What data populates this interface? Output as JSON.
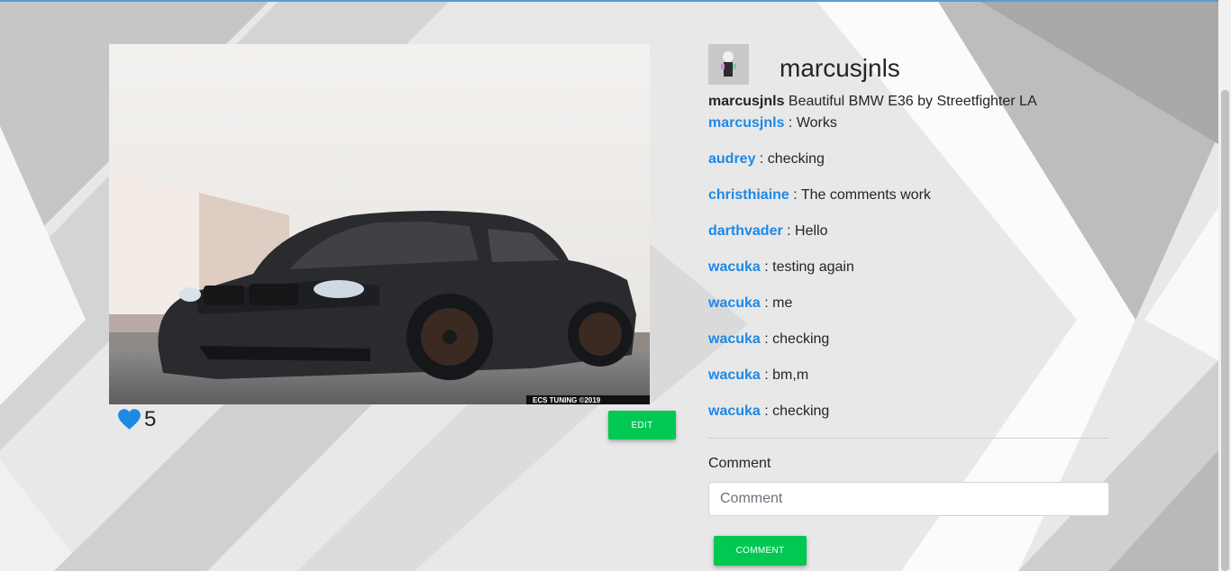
{
  "post": {
    "likes": "5",
    "edit_label": "EDIT",
    "image_watermark": "ECS TUNING ©2019"
  },
  "profile": {
    "username": "marcusjnls",
    "caption_user": "marcusjnls",
    "caption_text": " Beautiful BMW E36 by Streetfighter LA"
  },
  "comments": [
    {
      "user": "marcusjnls",
      "text": " : Works"
    },
    {
      "user": "audrey",
      "text": " : checking"
    },
    {
      "user": "christhiaine",
      "text": " : The comments work"
    },
    {
      "user": "darthvader",
      "text": " : Hello"
    },
    {
      "user": "wacuka",
      "text": " : testing again"
    },
    {
      "user": "wacuka",
      "text": " : me"
    },
    {
      "user": "wacuka",
      "text": " : checking"
    },
    {
      "user": "wacuka",
      "text": " : bm,m"
    },
    {
      "user": "wacuka",
      "text": " : checking"
    }
  ],
  "form": {
    "label": "Comment",
    "placeholder": "Comment",
    "submit_label": "COMMENT"
  },
  "colors": {
    "accent_blue": "#1e88e5",
    "button_green": "#00c853"
  }
}
